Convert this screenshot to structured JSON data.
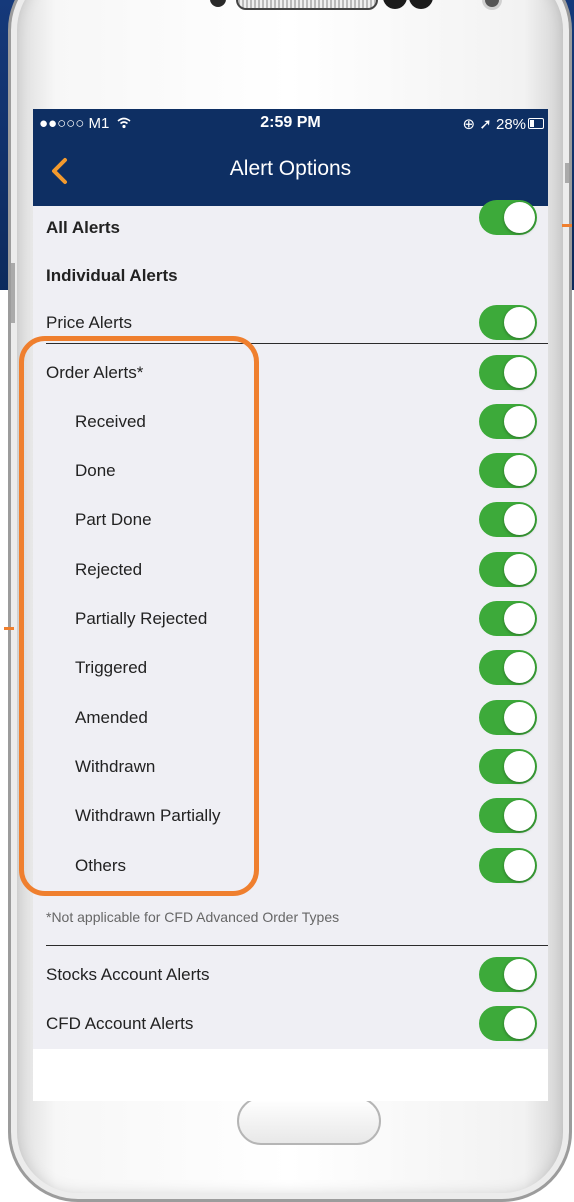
{
  "status_bar": {
    "carrier": "●●○○○ M1",
    "wifi_icon": "wifi-icon",
    "time": "2:59 PM",
    "right_info": "⊕ ➚ 28%",
    "battery_icon": "battery-icon"
  },
  "nav": {
    "back_icon": "chevron-left-icon",
    "title": "Alert Options"
  },
  "colors": {
    "nav_background": "#0e2f63",
    "toggle_on": "#3daa3a",
    "highlight": "#ef7f2e",
    "screen_background": "#efeff4"
  },
  "alerts": {
    "all": {
      "label": "All Alerts",
      "on": true
    },
    "individual_header": "Individual Alerts",
    "price": {
      "label": "Price Alerts",
      "on": true
    },
    "order": {
      "label": "Order Alerts*",
      "on": true
    },
    "received": {
      "label": "Received",
      "on": true
    },
    "done": {
      "label": "Done",
      "on": true
    },
    "part_done": {
      "label": "Part Done",
      "on": true
    },
    "rejected": {
      "label": "Rejected",
      "on": true
    },
    "partially_rejected": {
      "label": "Partially Rejected",
      "on": true
    },
    "triggered": {
      "label": "Triggered",
      "on": true
    },
    "amended": {
      "label": "Amended",
      "on": true
    },
    "withdrawn": {
      "label": "Withdrawn",
      "on": true
    },
    "withdrawn_partially": {
      "label": "Withdrawn Partially",
      "on": true
    },
    "others": {
      "label": "Others",
      "on": true
    },
    "footnote": "*Not applicable for CFD Advanced Order Types",
    "stocks_account": {
      "label": "Stocks Account Alerts",
      "on": true
    },
    "cfd_account": {
      "label": "CFD Account Alerts",
      "on": true
    }
  }
}
